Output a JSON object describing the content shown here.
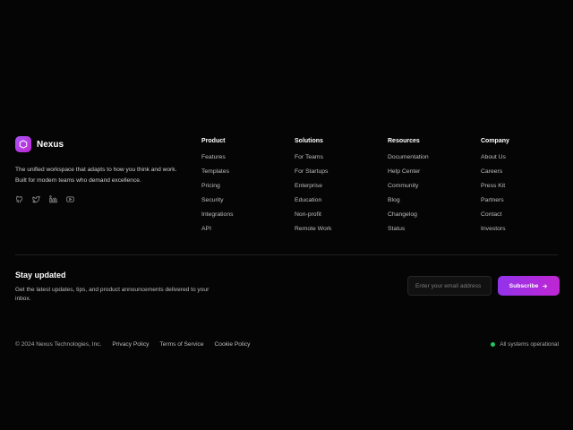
{
  "brand": {
    "name": "Nexus",
    "description": "The unified workspace that adapts to how you think and work. Built for modern teams who demand excellence.",
    "logo_icon": "hexagon-icon",
    "accent_color": "#a855f7",
    "socials": [
      {
        "icon": "github-icon"
      },
      {
        "icon": "twitter-icon"
      },
      {
        "icon": "linkedin-icon"
      },
      {
        "icon": "youtube-icon"
      }
    ]
  },
  "columns": [
    {
      "title": "Product",
      "links": [
        "Features",
        "Templates",
        "Pricing",
        "Security",
        "Integrations",
        "API"
      ]
    },
    {
      "title": "Solutions",
      "links": [
        "For Teams",
        "For Startups",
        "Enterprise",
        "Education",
        "Non-profit",
        "Remote Work"
      ]
    },
    {
      "title": "Resources",
      "links": [
        "Documentation",
        "Help Center",
        "Community",
        "Blog",
        "Changelog",
        "Status"
      ]
    },
    {
      "title": "Company",
      "links": [
        "About Us",
        "Careers",
        "Press Kit",
        "Partners",
        "Contact",
        "Investors"
      ]
    }
  ],
  "newsletter": {
    "title": "Stay updated",
    "description": "Get the latest updates, tips, and product announcements delivered to your inbox.",
    "email_placeholder": "Enter your email address",
    "email_value": "",
    "subscribe_label": "Subscribe",
    "subscribe_icon": "arrow-right-icon"
  },
  "bottom": {
    "copyright": "© 2024 Nexus Technologies, Inc.",
    "links": [
      "Privacy Policy",
      "Terms of Service",
      "Cookie Policy"
    ],
    "status_text": "All systems operational",
    "status_color": "#22c55e"
  }
}
